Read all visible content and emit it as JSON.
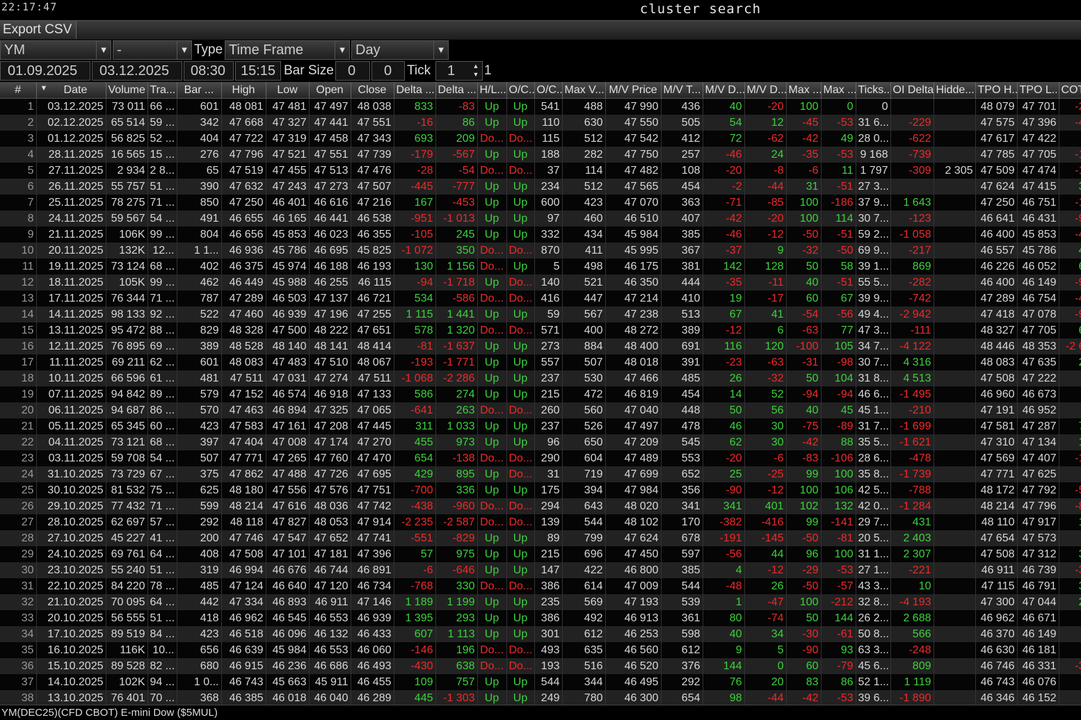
{
  "window": {
    "clock": "22:17:47",
    "title": "cluster search"
  },
  "toolbar": {
    "export_label": "Export CSV"
  },
  "controls": {
    "symbol": "YM",
    "second": "-",
    "type_label": "Type",
    "type_value": "Time Frame",
    "timeframe": "Day",
    "date_from": "01.09.2025",
    "date_to": "03.12.2025",
    "time_from": "08:30",
    "time_to": "15:15",
    "barsize_label": "Bar Size",
    "barsize_a": "0",
    "barsize_b": "0",
    "tick_label": "Tick",
    "tick_value": "1",
    "tick_suffix": "1"
  },
  "table": {
    "columns": [
      "#",
      "Date",
      "Volume",
      "Tra...",
      "Bar ...",
      "High",
      "Low",
      "Open",
      "Close",
      "Delta ...",
      "Delta ...",
      "H/L...",
      "O/C...",
      "O/C...",
      "Max V...",
      "M/V Price",
      "M/V T...",
      "M/V D...",
      "M/V D...",
      "Max ...",
      "Max ...",
      "Ticks...",
      "OI Delta",
      "Hidde...",
      "TPO H...",
      "TPO L...",
      "COT I"
    ],
    "sort_indicator": "▼",
    "rows": [
      [
        "1",
        "03.12.2025",
        "73 011",
        "66 ...",
        "601",
        "48 081",
        "47 481",
        "47 497",
        "48 038",
        "833",
        "-83",
        "Up",
        "Up",
        "541",
        "488",
        "47 990",
        "436",
        "40",
        "-20",
        "100",
        "0",
        "0",
        "",
        "",
        "48 079",
        "47 701",
        "-2"
      ],
      [
        "2",
        "02.12.2025",
        "65 514",
        "59 ...",
        "342",
        "47 668",
        "47 327",
        "47 441",
        "47 551",
        "-16",
        "86",
        "Up",
        "Up",
        "110",
        "630",
        "47 550",
        "505",
        "54",
        "12",
        "-45",
        "-53",
        "31 6...",
        "-229",
        "",
        "47 575",
        "47 396",
        "-4"
      ],
      [
        "3",
        "01.12.2025",
        "56 825",
        "52 ...",
        "404",
        "47 722",
        "47 319",
        "47 458",
        "47 343",
        "693",
        "209",
        "Do...",
        "Do...",
        "115",
        "512",
        "47 542",
        "412",
        "72",
        "-62",
        "-42",
        "49",
        "28 0...",
        "-622",
        "",
        "47 617",
        "47 422",
        ""
      ],
      [
        "4",
        "28.11.2025",
        "16 565",
        "15 ...",
        "276",
        "47 796",
        "47 521",
        "47 551",
        "47 739",
        "-179",
        "-567",
        "Up",
        "Up",
        "188",
        "282",
        "47 750",
        "257",
        "-46",
        "24",
        "-35",
        "-53",
        "9 168",
        "-739",
        "",
        "47 785",
        "47 705",
        "-1"
      ],
      [
        "5",
        "27.11.2025",
        "2 934",
        "2 8...",
        "65",
        "47 519",
        "47 455",
        "47 513",
        "47 476",
        "-28",
        "-54",
        "Do...",
        "Do...",
        "37",
        "114",
        "47 482",
        "108",
        "-20",
        "-8",
        "-6",
        "11",
        "1 797",
        "-309",
        "2 305",
        "47 509",
        "47 474",
        "-1"
      ],
      [
        "6",
        "26.11.2025",
        "55 757",
        "51 ...",
        "390",
        "47 632",
        "47 243",
        "47 273",
        "47 507",
        "-445",
        "-777",
        "Up",
        "Up",
        "234",
        "512",
        "47 565",
        "454",
        "-2",
        "-44",
        "31",
        "-51",
        "27 3...",
        "",
        "",
        "47 624",
        "47 415",
        "3"
      ],
      [
        "7",
        "25.11.2025",
        "78 275",
        "71 ...",
        "850",
        "47 250",
        "46 401",
        "46 616",
        "47 216",
        "167",
        "-453",
        "Up",
        "Up",
        "600",
        "423",
        "47 070",
        "363",
        "-71",
        "-85",
        "100",
        "-186",
        "37 9...",
        "1 643",
        "",
        "47 250",
        "46 751",
        "-1"
      ],
      [
        "8",
        "24.11.2025",
        "59 567",
        "54 ...",
        "491",
        "46 655",
        "46 165",
        "46 441",
        "46 538",
        "-951",
        "-1 013",
        "Up",
        "Up",
        "97",
        "460",
        "46 510",
        "407",
        "-42",
        "-20",
        "100",
        "114",
        "30 7...",
        "-123",
        "",
        "46 641",
        "46 431",
        "-9"
      ],
      [
        "9",
        "21.11.2025",
        "106K",
        "99 ...",
        "804",
        "46 656",
        "45 853",
        "46 023",
        "46 355",
        "-105",
        "245",
        "Up",
        "Up",
        "332",
        "434",
        "45 984",
        "385",
        "-46",
        "-12",
        "-50",
        "-51",
        "59 2...",
        "-1 058",
        "",
        "46 400",
        "45 853",
        "-4"
      ],
      [
        "10",
        "20.11.2025",
        "132K",
        "12...",
        "1 1...",
        "46 936",
        "45 786",
        "46 695",
        "45 825",
        "-1 072",
        "350",
        "Do...",
        "Do...",
        "870",
        "411",
        "45 995",
        "367",
        "-37",
        "9",
        "-32",
        "-50",
        "69 9...",
        "-217",
        "",
        "46 557",
        "45 786",
        "4"
      ],
      [
        "11",
        "19.11.2025",
        "73 124",
        "68 ...",
        "402",
        "46 375",
        "45 974",
        "46 188",
        "46 193",
        "130",
        "1 156",
        "Do...",
        "Up",
        "5",
        "498",
        "46 175",
        "381",
        "142",
        "128",
        "50",
        "58",
        "39 1...",
        "869",
        "",
        "46 226",
        "46 052",
        "6"
      ],
      [
        "12",
        "18.11.2025",
        "105K",
        "99 ...",
        "462",
        "46 449",
        "45 988",
        "46 255",
        "46 115",
        "-94",
        "-1 718",
        "Up",
        "Do...",
        "140",
        "521",
        "46 350",
        "444",
        "-35",
        "-11",
        "40",
        "-51",
        "55 5...",
        "-282",
        "",
        "46 400",
        "46 149",
        "-9"
      ],
      [
        "13",
        "17.11.2025",
        "76 344",
        "71 ...",
        "787",
        "47 289",
        "46 503",
        "47 137",
        "46 721",
        "534",
        "-586",
        "Do...",
        "Do...",
        "416",
        "447",
        "47 214",
        "410",
        "19",
        "-17",
        "60",
        "67",
        "39 9...",
        "-742",
        "",
        "47 289",
        "46 754",
        "-4"
      ],
      [
        "14",
        "14.11.2025",
        "98 133",
        "92 ...",
        "522",
        "47 460",
        "46 939",
        "47 196",
        "47 255",
        "1 115",
        "1 441",
        "Up",
        "Up",
        "59",
        "567",
        "47 238",
        "513",
        "67",
        "41",
        "-54",
        "-56",
        "49 4...",
        "-2 942",
        "",
        "47 418",
        "47 078",
        "-9"
      ],
      [
        "15",
        "13.11.2025",
        "95 472",
        "88 ...",
        "829",
        "48 328",
        "47 500",
        "48 222",
        "47 651",
        "578",
        "1 320",
        "Do...",
        "Do...",
        "571",
        "400",
        "48 272",
        "389",
        "-12",
        "6",
        "-63",
        "77",
        "47 3...",
        "-111",
        "",
        "48 327",
        "47 705",
        "6"
      ],
      [
        "16",
        "12.11.2025",
        "76 895",
        "69 ...",
        "389",
        "48 528",
        "48 140",
        "48 141",
        "48 414",
        "-81",
        "-1 637",
        "Up",
        "Up",
        "273",
        "884",
        "48 400",
        "691",
        "116",
        "120",
        "-100",
        "105",
        "34 7...",
        "-4 122",
        "",
        "48 446",
        "48 353",
        "-2 6"
      ],
      [
        "17",
        "11.11.2025",
        "69 211",
        "62 ...",
        "601",
        "48 083",
        "47 483",
        "47 510",
        "48 067",
        "-193",
        "-1 771",
        "Up",
        "Up",
        "557",
        "507",
        "48 018",
        "391",
        "-23",
        "-63",
        "-31",
        "-98",
        "30 7...",
        "4 316",
        "",
        "48 083",
        "47 635",
        "2"
      ],
      [
        "18",
        "10.11.2025",
        "66 596",
        "61 ...",
        "481",
        "47 511",
        "47 031",
        "47 274",
        "47 511",
        "-1 068",
        "-2 286",
        "Up",
        "Up",
        "237",
        "530",
        "47 466",
        "485",
        "26",
        "-32",
        "50",
        "104",
        "31 8...",
        "4 513",
        "",
        "47 508",
        "47 222",
        ""
      ],
      [
        "19",
        "07.11.2025",
        "94 842",
        "89 ...",
        "579",
        "47 152",
        "46 574",
        "46 918",
        "47 133",
        "586",
        "274",
        "Up",
        "Up",
        "215",
        "472",
        "46 819",
        "454",
        "14",
        "52",
        "-94",
        "-94",
        "46 6...",
        "-1 495",
        "",
        "46 960",
        "46 673",
        ""
      ],
      [
        "20",
        "06.11.2025",
        "94 687",
        "86 ...",
        "570",
        "47 463",
        "46 894",
        "47 325",
        "47 065",
        "-641",
        "263",
        "Do...",
        "Do...",
        "260",
        "560",
        "47 040",
        "448",
        "50",
        "56",
        "40",
        "45",
        "45 1...",
        "-210",
        "",
        "47 191",
        "46 952",
        ""
      ],
      [
        "21",
        "05.11.2025",
        "65 345",
        "60 ...",
        "423",
        "47 583",
        "47 161",
        "47 208",
        "47 445",
        "311",
        "1 033",
        "Up",
        "Up",
        "237",
        "526",
        "47 497",
        "478",
        "46",
        "30",
        "-75",
        "-89",
        "31 7...",
        "-1 699",
        "",
        "47 581",
        "47 287",
        "7"
      ],
      [
        "22",
        "04.11.2025",
        "73 121",
        "68 ...",
        "397",
        "47 404",
        "47 008",
        "47 174",
        "47 270",
        "455",
        "973",
        "Up",
        "Up",
        "96",
        "650",
        "47 209",
        "545",
        "62",
        "30",
        "-42",
        "88",
        "35 5...",
        "-1 621",
        "",
        "47 310",
        "47 134",
        "1"
      ],
      [
        "23",
        "03.11.2025",
        "59 708",
        "54 ...",
        "507",
        "47 771",
        "47 265",
        "47 760",
        "47 470",
        "654",
        "-138",
        "Do...",
        "Do...",
        "290",
        "604",
        "47 489",
        "553",
        "-20",
        "-6",
        "-83",
        "-106",
        "28 6...",
        "-478",
        "",
        "47 569",
        "47 407",
        "-1"
      ],
      [
        "24",
        "31.10.2025",
        "73 729",
        "67 ...",
        "375",
        "47 862",
        "47 488",
        "47 726",
        "47 695",
        "429",
        "895",
        "Up",
        "Do...",
        "31",
        "719",
        "47 699",
        "652",
        "25",
        "-25",
        "99",
        "100",
        "35 8...",
        "-1 739",
        "",
        "47 771",
        "47 625",
        "-"
      ],
      [
        "25",
        "30.10.2025",
        "81 532",
        "75 ...",
        "625",
        "48 180",
        "47 556",
        "47 576",
        "47 751",
        "-700",
        "336",
        "Up",
        "Up",
        "175",
        "394",
        "47 984",
        "356",
        "-90",
        "-12",
        "100",
        "106",
        "42 5...",
        "-788",
        "",
        "48 172",
        "47 792",
        "-5"
      ],
      [
        "26",
        "29.10.2025",
        "77 432",
        "71 ...",
        "599",
        "48 214",
        "47 616",
        "48 036",
        "47 742",
        "-438",
        "-960",
        "Do...",
        "Do...",
        "294",
        "643",
        "48 020",
        "341",
        "341",
        "401",
        "102",
        "132",
        "42 0...",
        "-1 284",
        "",
        "48 214",
        "47 796",
        "-8"
      ],
      [
        "27",
        "28.10.2025",
        "62 697",
        "57 ...",
        "292",
        "48 118",
        "47 827",
        "48 053",
        "47 914",
        "-2 235",
        "-2 587",
        "Do...",
        "Do...",
        "139",
        "544",
        "48 102",
        "170",
        "-382",
        "-416",
        "99",
        "-141",
        "29 7...",
        "431",
        "",
        "48 110",
        "47 917",
        "1"
      ],
      [
        "28",
        "27.10.2025",
        "45 227",
        "41 ...",
        "200",
        "47 746",
        "47 547",
        "47 652",
        "47 741",
        "-551",
        "-829",
        "Up",
        "Up",
        "89",
        "799",
        "47 624",
        "678",
        "-191",
        "-145",
        "-50",
        "-81",
        "20 5...",
        "2 403",
        "",
        "47 654",
        "47 573",
        ""
      ],
      [
        "29",
        "24.10.2025",
        "69 761",
        "64 ...",
        "408",
        "47 508",
        "47 101",
        "47 181",
        "47 396",
        "57",
        "975",
        "Up",
        "Up",
        "215",
        "696",
        "47 450",
        "597",
        "-56",
        "44",
        "96",
        "100",
        "31 1...",
        "2 307",
        "",
        "47 508",
        "47 312",
        "3"
      ],
      [
        "30",
        "23.10.2025",
        "55 240",
        "51 ...",
        "319",
        "46 994",
        "46 676",
        "46 744",
        "46 891",
        "-6",
        "-646",
        "Up",
        "Up",
        "147",
        "422",
        "46 800",
        "385",
        "4",
        "-12",
        "-29",
        "-53",
        "27 1...",
        "-221",
        "",
        "46 911",
        "46 739",
        "-3"
      ],
      [
        "31",
        "22.10.2025",
        "84 220",
        "78 ...",
        "485",
        "47 124",
        "46 640",
        "47 120",
        "46 734",
        "-768",
        "330",
        "Do...",
        "Do...",
        "386",
        "614",
        "47 009",
        "544",
        "-48",
        "26",
        "-50",
        "-57",
        "43 3...",
        "10",
        "",
        "47 115",
        "46 791",
        "3"
      ],
      [
        "32",
        "21.10.2025",
        "70 095",
        "64 ...",
        "442",
        "47 334",
        "46 893",
        "46 911",
        "47 146",
        "1 189",
        "1 199",
        "Up",
        "Up",
        "235",
        "569",
        "47 193",
        "539",
        "1",
        "-47",
        "100",
        "-212",
        "32 8...",
        "-4 193",
        "",
        "47 300",
        "47 044",
        "2"
      ],
      [
        "33",
        "20.10.2025",
        "56 555",
        "51 ...",
        "418",
        "46 962",
        "46 545",
        "46 553",
        "46 939",
        "1 395",
        "293",
        "Up",
        "Up",
        "386",
        "492",
        "46 913",
        "361",
        "80",
        "-74",
        "50",
        "144",
        "26 2...",
        "2 688",
        "",
        "46 962",
        "46 671",
        "-"
      ],
      [
        "34",
        "17.10.2025",
        "89 519",
        "84 ...",
        "423",
        "46 518",
        "46 096",
        "46 132",
        "46 433",
        "607",
        "1 113",
        "Up",
        "Up",
        "301",
        "612",
        "46 253",
        "598",
        "40",
        "34",
        "-30",
        "-61",
        "50 8...",
        "566",
        "",
        "46 370",
        "46 149",
        "-"
      ],
      [
        "35",
        "16.10.2025",
        "116K",
        "10...",
        "656",
        "46 639",
        "45 984",
        "46 553",
        "46 060",
        "-146",
        "196",
        "Do...",
        "Do...",
        "493",
        "635",
        "46 560",
        "612",
        "9",
        "5",
        "-90",
        "93",
        "63 3...",
        "-248",
        "",
        "46 630",
        "46 181",
        "-"
      ],
      [
        "36",
        "15.10.2025",
        "89 528",
        "82 ...",
        "680",
        "46 915",
        "46 236",
        "46 686",
        "46 493",
        "-430",
        "638",
        "Do...",
        "Do...",
        "193",
        "516",
        "46 520",
        "376",
        "144",
        "0",
        "60",
        "-79",
        "45 6...",
        "809",
        "",
        "46 746",
        "46 331",
        "-3"
      ],
      [
        "37",
        "14.10.2025",
        "102K",
        "94 ...",
        "1 0...",
        "46 743",
        "45 663",
        "45 911",
        "46 455",
        "109",
        "757",
        "Up",
        "Up",
        "544",
        "344",
        "46 495",
        "292",
        "76",
        "20",
        "83",
        "86",
        "52 1...",
        "1 119",
        "",
        "46 743",
        "46 076",
        "-"
      ],
      [
        "38",
        "13.10.2025",
        "76 401",
        "70 ...",
        "368",
        "46 385",
        "46 018",
        "46 040",
        "46 289",
        "445",
        "-1 303",
        "Up",
        "Up",
        "249",
        "780",
        "46 300",
        "654",
        "98",
        "-44",
        "-42",
        "-53",
        "39 6...",
        "-1 890",
        "",
        "46 346",
        "46 152",
        "-"
      ]
    ]
  },
  "status": {
    "instrument": "YM(DEC25)(CFD CBOT) E-mini Dow ($5MUL)"
  },
  "colors": {
    "positive": "#3cd23c",
    "negative": "#ee2a2a",
    "background": "#000000"
  }
}
